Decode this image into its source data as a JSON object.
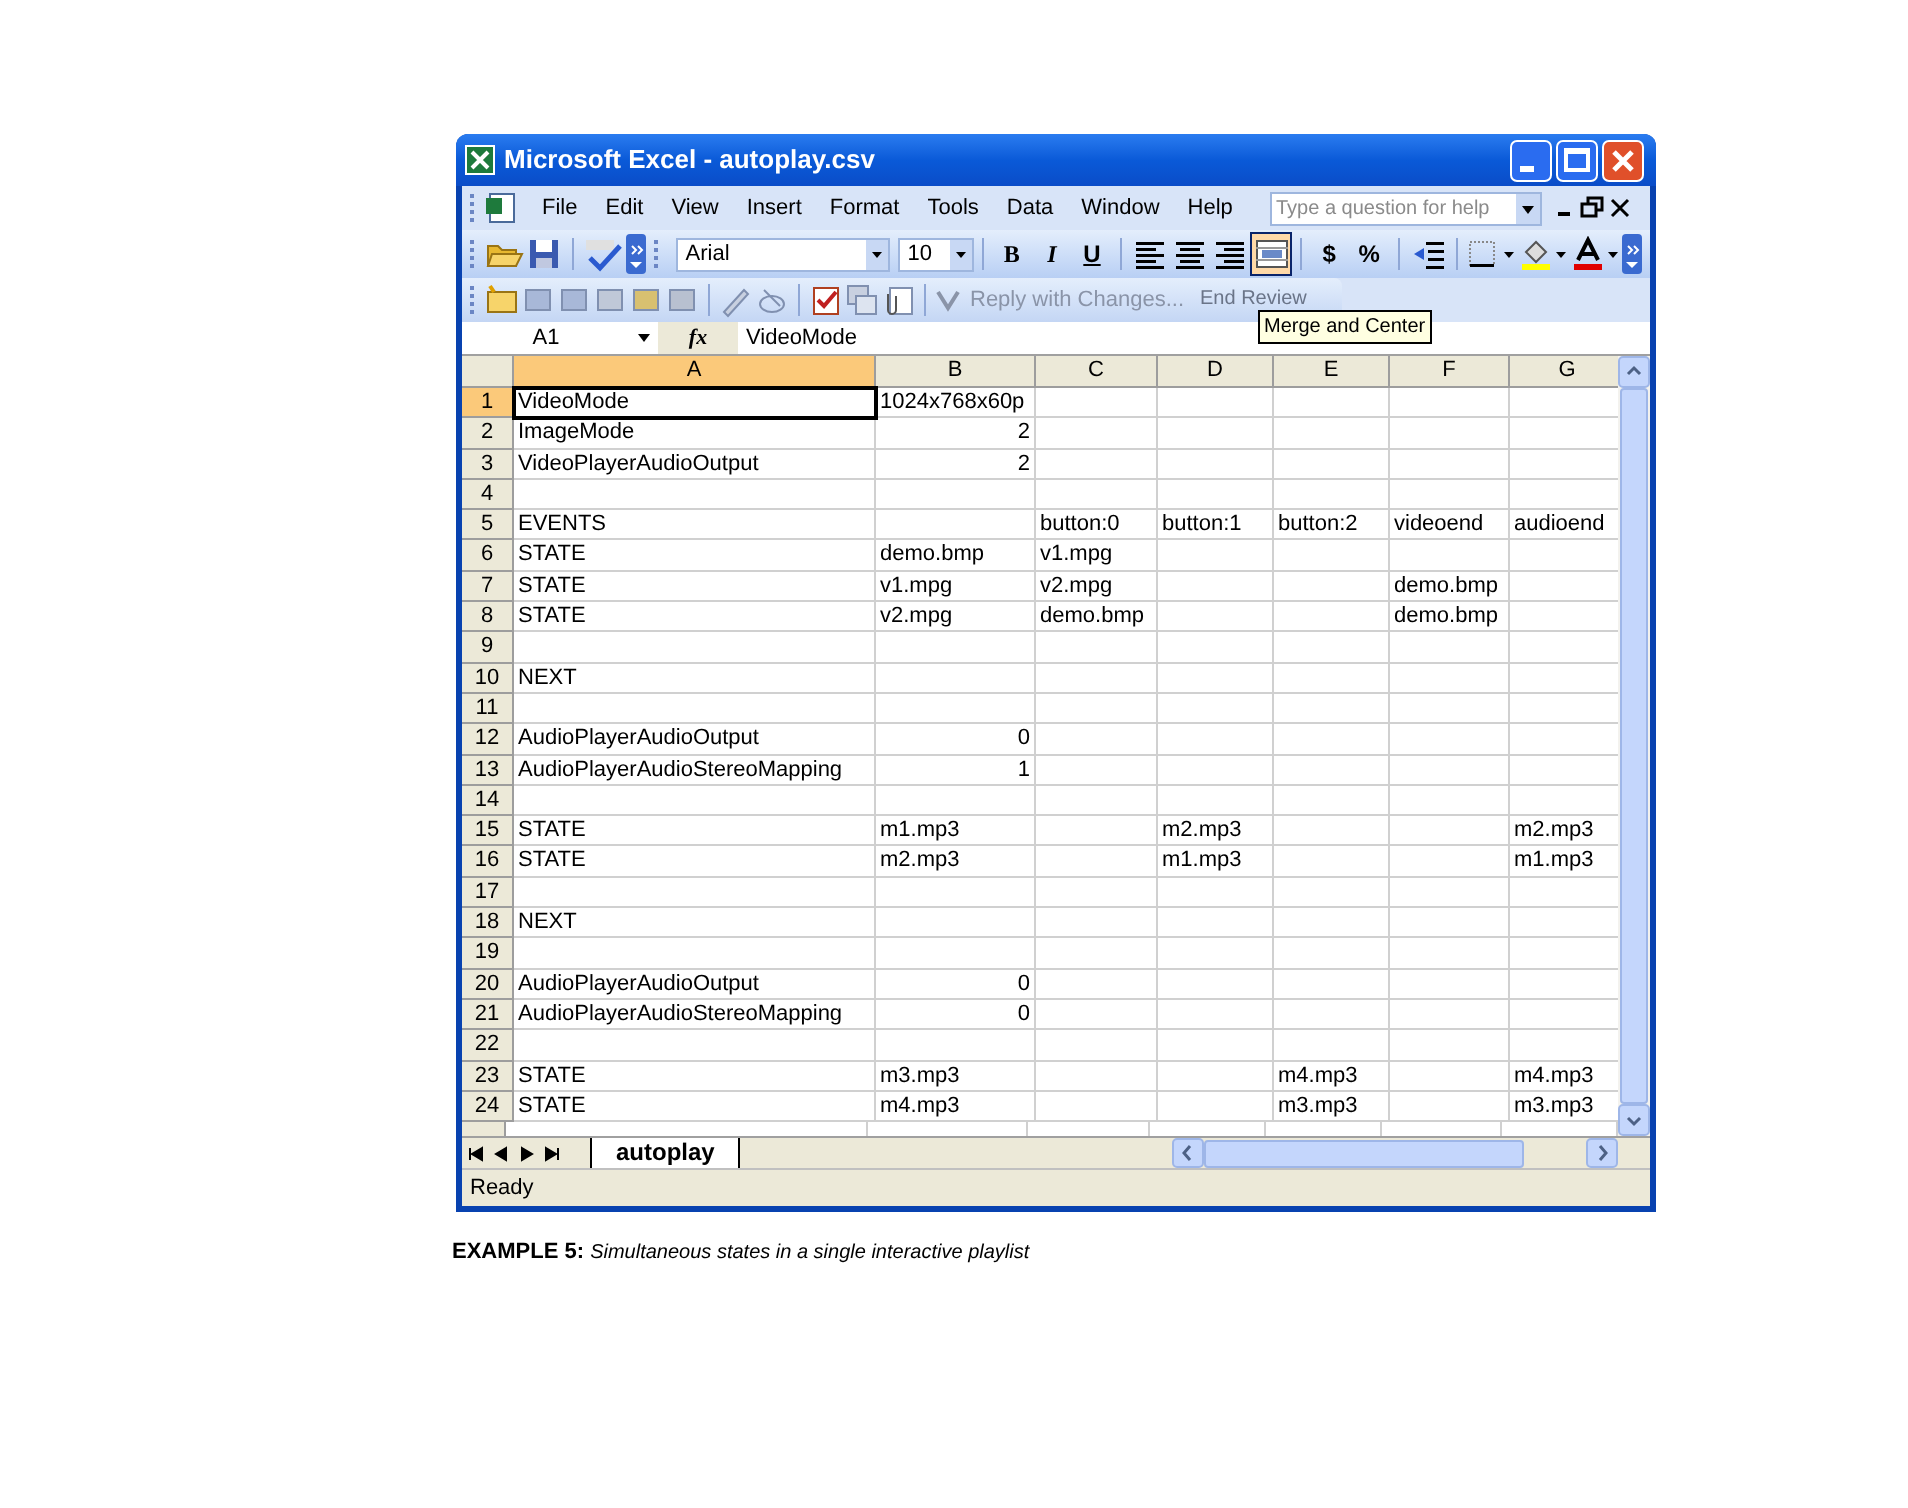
{
  "window": {
    "title": "Microsoft Excel - autoplay.csv"
  },
  "menu": [
    {
      "label": "File"
    },
    {
      "label": "Edit"
    },
    {
      "label": "View"
    },
    {
      "label": "Insert"
    },
    {
      "label": "Format"
    },
    {
      "label": "Tools"
    },
    {
      "label": "Data"
    },
    {
      "label": "Window"
    },
    {
      "label": "Help"
    }
  ],
  "help_box": {
    "placeholder": "Type a question for help"
  },
  "formatting_toolbar": {
    "font": "Arial",
    "size": "10",
    "style_buttons": [
      "B",
      "I",
      "U"
    ],
    "currency": "$",
    "percent": "%",
    "merge_and_center_pressed": true
  },
  "reviewing_toolbar": {
    "reply": "Reply with Changes...",
    "end_review": "End Review"
  },
  "tooltip": "Merge and Center",
  "formula_bar": {
    "name_box": "A1",
    "function_label": "fx",
    "value": "VideoMode"
  },
  "columns": [
    {
      "label": "A",
      "selected": true
    },
    {
      "label": "B",
      "selected": false
    },
    {
      "label": "C",
      "selected": false
    },
    {
      "label": "D",
      "selected": false
    },
    {
      "label": "E",
      "selected": false
    },
    {
      "label": "F",
      "selected": false
    },
    {
      "label": "G",
      "selected": false
    }
  ],
  "rows": [
    {
      "header": "1",
      "selected": true,
      "cells": [
        {
          "text": "VideoMode",
          "active": true
        },
        {
          "text": "1024x768x60p",
          "kind": "text"
        },
        null,
        null,
        null,
        null,
        null
      ]
    },
    {
      "header": "2",
      "selected": false,
      "cells": [
        {
          "text": "ImageMode"
        },
        {
          "text": "2",
          "kind": "number"
        },
        null,
        null,
        null,
        null,
        null
      ]
    },
    {
      "header": "3",
      "selected": false,
      "cells": [
        {
          "text": "VideoPlayerAudioOutput"
        },
        {
          "text": "2",
          "kind": "number"
        },
        null,
        null,
        null,
        null,
        null
      ]
    },
    {
      "header": "4",
      "selected": false,
      "cells": [
        null,
        null,
        null,
        null,
        null,
        null,
        null
      ]
    },
    {
      "header": "5",
      "selected": false,
      "cells": [
        {
          "text": "EVENTS"
        },
        null,
        {
          "text": "button:0"
        },
        {
          "text": "button:1"
        },
        {
          "text": "button:2"
        },
        {
          "text": "videoend"
        },
        {
          "text": "audioend"
        }
      ]
    },
    {
      "header": "6",
      "selected": false,
      "cells": [
        {
          "text": "STATE"
        },
        {
          "text": "demo.bmp"
        },
        {
          "text": "v1.mpg"
        },
        null,
        null,
        null,
        null
      ]
    },
    {
      "header": "7",
      "selected": false,
      "cells": [
        {
          "text": "STATE"
        },
        {
          "text": "v1.mpg"
        },
        {
          "text": "v2.mpg"
        },
        null,
        null,
        {
          "text": "demo.bmp"
        },
        null
      ]
    },
    {
      "header": "8",
      "selected": false,
      "cells": [
        {
          "text": "STATE"
        },
        {
          "text": "v2.mpg"
        },
        {
          "text": "demo.bmp"
        },
        null,
        null,
        {
          "text": "demo.bmp"
        },
        null
      ]
    },
    {
      "header": "9",
      "selected": false,
      "cells": [
        null,
        null,
        null,
        null,
        null,
        null,
        null
      ]
    },
    {
      "header": "10",
      "selected": false,
      "cells": [
        {
          "text": "NEXT"
        },
        null,
        null,
        null,
        null,
        null,
        null
      ]
    },
    {
      "header": "11",
      "selected": false,
      "cells": [
        null,
        null,
        null,
        null,
        null,
        null,
        null
      ]
    },
    {
      "header": "12",
      "selected": false,
      "cells": [
        {
          "text": "AudioPlayerAudioOutput"
        },
        {
          "text": "0",
          "kind": "number"
        },
        null,
        null,
        null,
        null,
        null
      ]
    },
    {
      "header": "13",
      "selected": false,
      "cells": [
        {
          "text": "AudioPlayerAudioStereoMapping"
        },
        {
          "text": "1",
          "kind": "number"
        },
        null,
        null,
        null,
        null,
        null
      ]
    },
    {
      "header": "14",
      "selected": false,
      "cells": [
        null,
        null,
        null,
        null,
        null,
        null,
        null
      ]
    },
    {
      "header": "15",
      "selected": false,
      "cells": [
        {
          "text": "STATE"
        },
        {
          "text": "m1.mp3"
        },
        null,
        {
          "text": "m2.mp3"
        },
        null,
        null,
        {
          "text": "m2.mp3"
        }
      ]
    },
    {
      "header": "16",
      "selected": false,
      "cells": [
        {
          "text": "STATE"
        },
        {
          "text": "m2.mp3"
        },
        null,
        {
          "text": "m1.mp3"
        },
        null,
        null,
        {
          "text": "m1.mp3"
        }
      ]
    },
    {
      "header": "17",
      "selected": false,
      "cells": [
        null,
        null,
        null,
        null,
        null,
        null,
        null
      ]
    },
    {
      "header": "18",
      "selected": false,
      "cells": [
        {
          "text": "NEXT"
        },
        null,
        null,
        null,
        null,
        null,
        null
      ]
    },
    {
      "header": "19",
      "selected": false,
      "cells": [
        null,
        null,
        null,
        null,
        null,
        null,
        null
      ]
    },
    {
      "header": "20",
      "selected": false,
      "cells": [
        {
          "text": "AudioPlayerAudioOutput"
        },
        {
          "text": "0",
          "kind": "number"
        },
        null,
        null,
        null,
        null,
        null
      ]
    },
    {
      "header": "21",
      "selected": false,
      "cells": [
        {
          "text": "AudioPlayerAudioStereoMapping"
        },
        {
          "text": "0",
          "kind": "number"
        },
        null,
        null,
        null,
        null,
        null
      ]
    },
    {
      "header": "22",
      "selected": false,
      "cells": [
        null,
        null,
        null,
        null,
        null,
        null,
        null
      ]
    },
    {
      "header": "23",
      "selected": false,
      "cells": [
        {
          "text": "STATE"
        },
        {
          "text": "m3.mp3"
        },
        null,
        null,
        {
          "text": "m4.mp3"
        },
        null,
        {
          "text": "m4.mp3"
        }
      ]
    },
    {
      "header": "24",
      "selected": false,
      "cells": [
        {
          "text": "STATE"
        },
        {
          "text": "m4.mp3"
        },
        null,
        null,
        {
          "text": "m3.mp3"
        },
        null,
        {
          "text": "m3.mp3"
        }
      ]
    }
  ],
  "sheet_tabs": [
    {
      "label": "autoplay",
      "selected": true
    }
  ],
  "status_bar": {
    "text": "Ready"
  },
  "caption": {
    "label": "EXAMPLE 5:",
    "text": "Simultaneous states in a single interactive playlist"
  }
}
